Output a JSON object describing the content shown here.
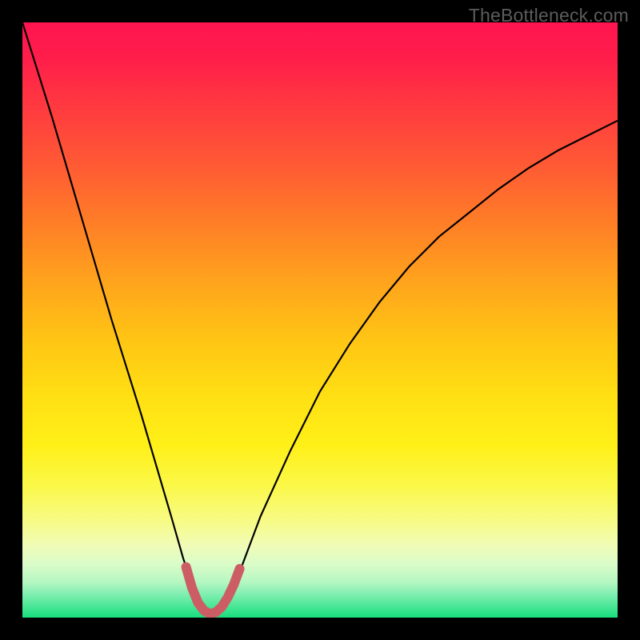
{
  "watermark": "TheBottleneck.com",
  "colors": {
    "page_bg": "#000000",
    "curve_stroke": "#000000",
    "marker_stroke": "#cd5d64",
    "gradient_top": "#ff1450",
    "gradient_bottom": "#18dd7e"
  },
  "chart_data": {
    "type": "line",
    "title": "",
    "xlabel": "",
    "ylabel": "",
    "xlim": [
      0,
      100
    ],
    "ylim": [
      0,
      100
    ],
    "grid": false,
    "legend_position": "none",
    "series": [
      {
        "name": "bottleneck-curve",
        "x": [
          0,
          5,
          10,
          15,
          20,
          25,
          27,
          29,
          30,
          31,
          32,
          33,
          34,
          35,
          37,
          40,
          45,
          50,
          55,
          60,
          65,
          70,
          75,
          80,
          85,
          90,
          95,
          100
        ],
        "values": [
          100,
          84,
          67,
          50,
          34,
          17,
          10,
          4,
          2,
          1,
          0.5,
          1,
          2,
          4,
          9,
          17,
          28,
          38,
          46,
          53,
          59,
          64,
          68,
          72,
          75.5,
          78.5,
          81,
          83.5
        ]
      },
      {
        "name": "highlighted-minimum",
        "x": [
          27.5,
          28.5,
          29.5,
          30.5,
          31.5,
          32.5,
          33.5,
          34.5,
          35.5,
          36.5
        ],
        "values": [
          8.5,
          5,
          2.5,
          1.2,
          0.6,
          0.9,
          1.8,
          3.4,
          5.5,
          8.2
        ]
      }
    ],
    "annotations": [
      {
        "text": "TheBottleneck.com",
        "position": "top-right"
      }
    ]
  }
}
